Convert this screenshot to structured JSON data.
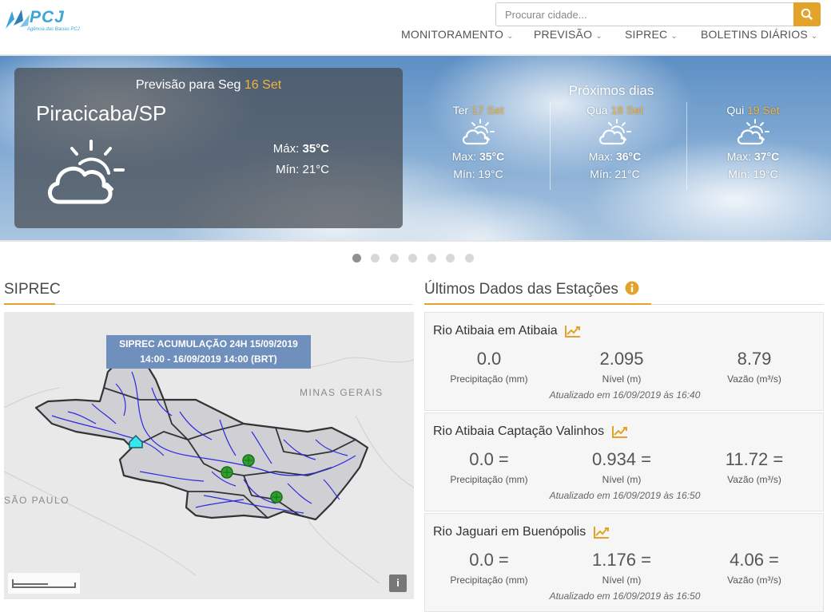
{
  "header": {
    "logo_text": "PCJ",
    "logo_sub": "Agência das Bacias PCJ",
    "search_placeholder": "Procurar cidade...",
    "nav": [
      {
        "label": "MONITORAMENTO"
      },
      {
        "label": "PREVISÃO"
      },
      {
        "label": "SIPREC"
      },
      {
        "label": "BOLETINS DIÁRIOS"
      }
    ]
  },
  "forecast": {
    "title_prefix": "Previsão para Seg",
    "title_date": "16 Set",
    "city": "Piracicaba/SP",
    "max_label": "Máx:",
    "max_value": "35°C",
    "min_label": "Mín:",
    "min_value": "21°C",
    "icon": "partly-cloudy-icon"
  },
  "next_days": {
    "title": "Próximos dias",
    "days": [
      {
        "weekday": "Ter",
        "date": "17 Set",
        "max_label": "Max:",
        "max": "35°C",
        "min_label": "Mín:",
        "min": "19°C"
      },
      {
        "weekday": "Qua",
        "date": "18 Set",
        "max_label": "Max:",
        "max": "36°C",
        "min_label": "Mín:",
        "min": "21°C"
      },
      {
        "weekday": "Qui",
        "date": "19 Set",
        "max_label": "Max:",
        "max": "37°C",
        "min_label": "Mín:",
        "min": "19°C"
      }
    ]
  },
  "carousel": {
    "count": 7,
    "active_index": 0
  },
  "siprec": {
    "title": "SIPREC",
    "map_label_line1": "SIPREC ACUMULAÇÃO 24H  15/09/2019",
    "map_label_line2": "14:00 - 16/09/2019 14:00 (BRT)",
    "region_mg": "MINAS GERAIS",
    "region_sp": "SÃO PAULO",
    "info_label": "i"
  },
  "stations": {
    "title": "Últimos Dados das Estações",
    "cards": [
      {
        "name": "Rio Atibaia em Atibaia",
        "precip": "0.0",
        "nivel": "2.095",
        "vazao": "8.79",
        "precip_label": "Precipitação (mm)",
        "nivel_label": "Nível (m)",
        "vazao_label": "Vazão (m³/s)",
        "updated": "Atualizado em 16/09/2019 às 16:40"
      },
      {
        "name": "Rio Atibaia Captação Valinhos",
        "precip": "0.0 =",
        "nivel": "0.934 =",
        "vazao": "11.72 =",
        "precip_label": "Precipitação (mm)",
        "nivel_label": "Nível (m)",
        "vazao_label": "Vazão (m³/s)",
        "updated": "Atualizado em 16/09/2019 às 16:50"
      },
      {
        "name": "Rio Jaguari em Buenópolis",
        "precip": "0.0 =",
        "nivel": "1.176 =",
        "vazao": "4.06 =",
        "precip_label": "Precipitação (mm)",
        "nivel_label": "Nível (m)",
        "vazao_label": "Vazão (m³/s)",
        "updated": "Atualizado em 16/09/2019 às 16:50"
      }
    ]
  },
  "colors": {
    "accent": "#e3a32b",
    "date_highlight": "#f0b53a",
    "map_label_bg": "#6f8fbd"
  }
}
